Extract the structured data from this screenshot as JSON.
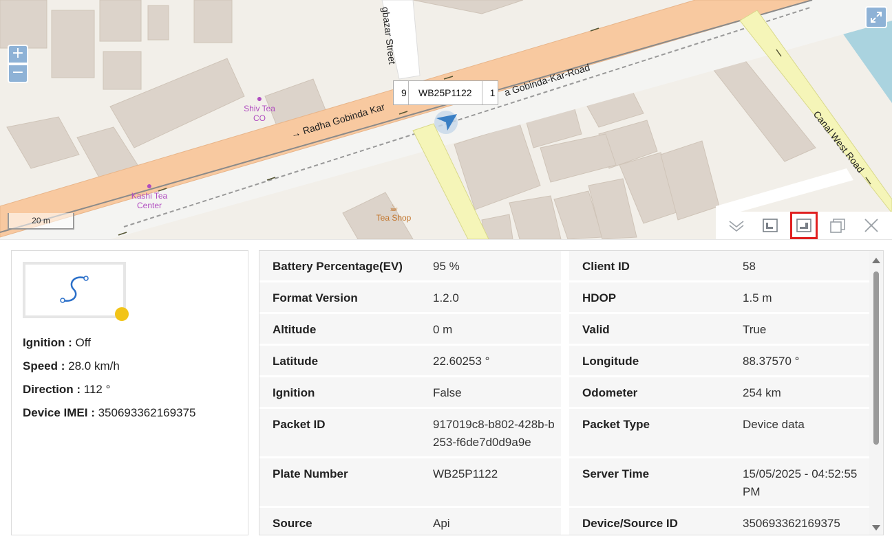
{
  "map": {
    "zoom_in": "+",
    "zoom_out": "−",
    "scale": "20 m",
    "streets": {
      "main_left": "→ Radha Gobinda Kar",
      "main_right": "a Gobinda-Kar-Road",
      "cross": "gbazar Street",
      "canal": "Canal West Road"
    },
    "pois": {
      "shiv": "Shiv Tea CO",
      "kashi": "Kashi Tea Center",
      "teashop": "Tea Shop"
    },
    "vehicle_label": {
      "left": "9",
      "plate": "WB25P1122",
      "right": "1"
    }
  },
  "toolbar": {
    "collapse": "chevron-down-icon",
    "dock_left": "panel-left-icon",
    "dock_right": "panel-right-icon",
    "maximize": "maximize-icon",
    "close": "close-icon"
  },
  "summary": {
    "ignition_label": "Ignition :",
    "ignition_value": " Off",
    "speed_label": "Speed :",
    "speed_value": " 28.0 km/h",
    "direction_label": "Direction :",
    "direction_value": " 112 °",
    "imei_label": "Device IMEI :",
    "imei_value": " 350693362169375"
  },
  "details": [
    {
      "lk": "Battery Percentage(EV)",
      "lv": "95 %",
      "rk": "Client ID",
      "rv": "58"
    },
    {
      "lk": "Format Version",
      "lv": "1.2.0",
      "rk": "HDOP",
      "rv": "1.5 m"
    },
    {
      "lk": "Altitude",
      "lv": "0 m",
      "rk": "Valid",
      "rv": "True"
    },
    {
      "lk": "Latitude",
      "lv": "22.60253 °",
      "rk": "Longitude",
      "rv": "88.37570 °"
    },
    {
      "lk": "Ignition",
      "lv": "False",
      "rk": "Odometer",
      "rv": "254 km"
    },
    {
      "lk": "Packet ID",
      "lv": "917019c8-b802-428b-b253-f6de7d0d9a9e",
      "rk": "Packet Type",
      "rv": "Device data"
    },
    {
      "lk": "Plate Number",
      "lv": "WB25P1122",
      "rk": "Server Time",
      "rv": "15/05/2025 - 04:52:55 PM"
    },
    {
      "lk": "Source",
      "lv": "Api",
      "rk": "Device/Source ID",
      "rv": "350693362169375"
    }
  ],
  "colors": {
    "road_main": "#f8c9a0",
    "road_minor": "#f5f5b8",
    "building": "#dcd3ca",
    "water": "#aad3df",
    "highlight": "#e02020"
  }
}
